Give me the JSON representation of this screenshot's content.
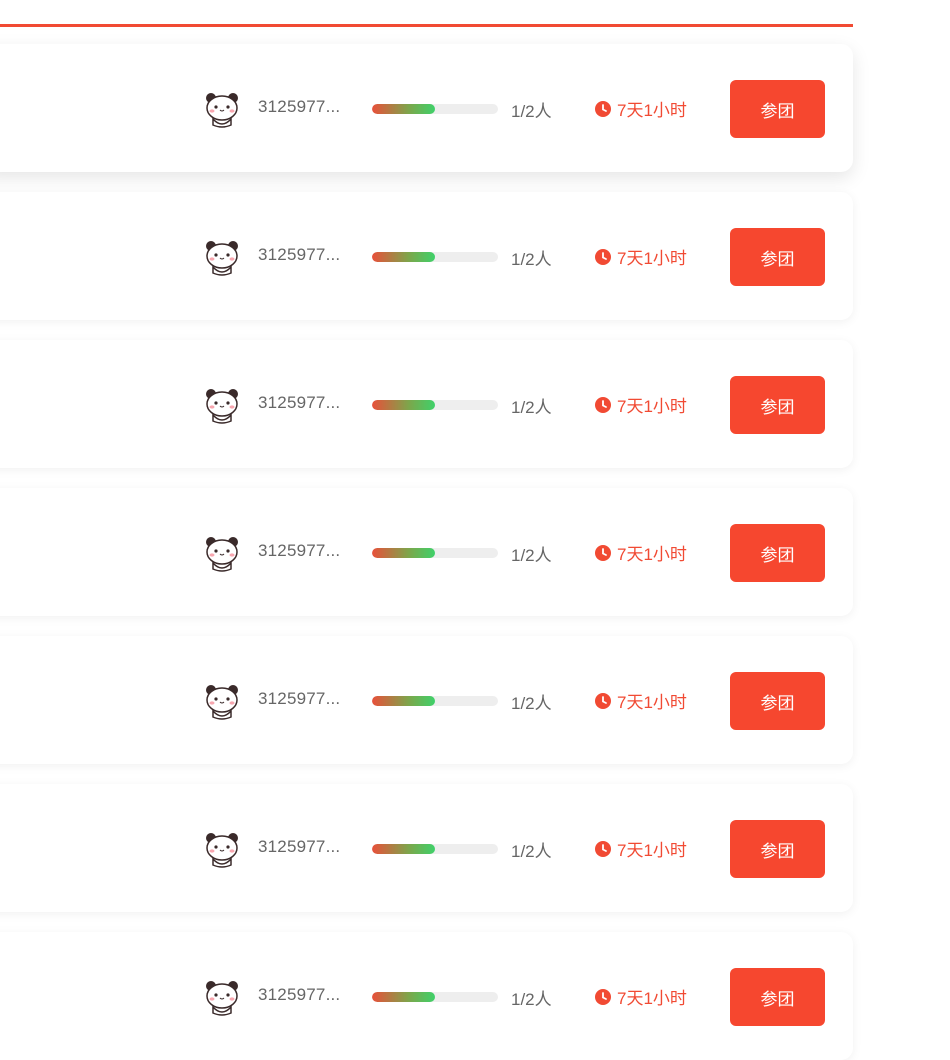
{
  "theme": {
    "accent": "#f14a33",
    "button_bg": "#f6472f",
    "progress_start": "#e8503a",
    "progress_end": "#3fd16a",
    "track": "#eeeeee"
  },
  "rows": [
    {
      "user": "3125977...",
      "progress_fraction": 0.5,
      "count": "1/2人",
      "time_left": "7天1小时",
      "join_label": "参团",
      "avatar_icon": "panda-avatar-icon",
      "timer_icon": "clock-icon"
    },
    {
      "user": "3125977...",
      "progress_fraction": 0.5,
      "count": "1/2人",
      "time_left": "7天1小时",
      "join_label": "参团",
      "avatar_icon": "panda-avatar-icon",
      "timer_icon": "clock-icon"
    },
    {
      "user": "3125977...",
      "progress_fraction": 0.5,
      "count": "1/2人",
      "time_left": "7天1小时",
      "join_label": "参团",
      "avatar_icon": "panda-avatar-icon",
      "timer_icon": "clock-icon"
    },
    {
      "user": "3125977...",
      "progress_fraction": 0.5,
      "count": "1/2人",
      "time_left": "7天1小时",
      "join_label": "参团",
      "avatar_icon": "panda-avatar-icon",
      "timer_icon": "clock-icon"
    },
    {
      "user": "3125977...",
      "progress_fraction": 0.5,
      "count": "1/2人",
      "time_left": "7天1小时",
      "join_label": "参团",
      "avatar_icon": "panda-avatar-icon",
      "timer_icon": "clock-icon"
    },
    {
      "user": "3125977...",
      "progress_fraction": 0.5,
      "count": "1/2人",
      "time_left": "7天1小时",
      "join_label": "参团",
      "avatar_icon": "panda-avatar-icon",
      "timer_icon": "clock-icon"
    },
    {
      "user": "3125977...",
      "progress_fraction": 0.5,
      "count": "1/2人",
      "time_left": "7天1小时",
      "join_label": "参团",
      "avatar_icon": "panda-avatar-icon",
      "timer_icon": "clock-icon"
    }
  ]
}
